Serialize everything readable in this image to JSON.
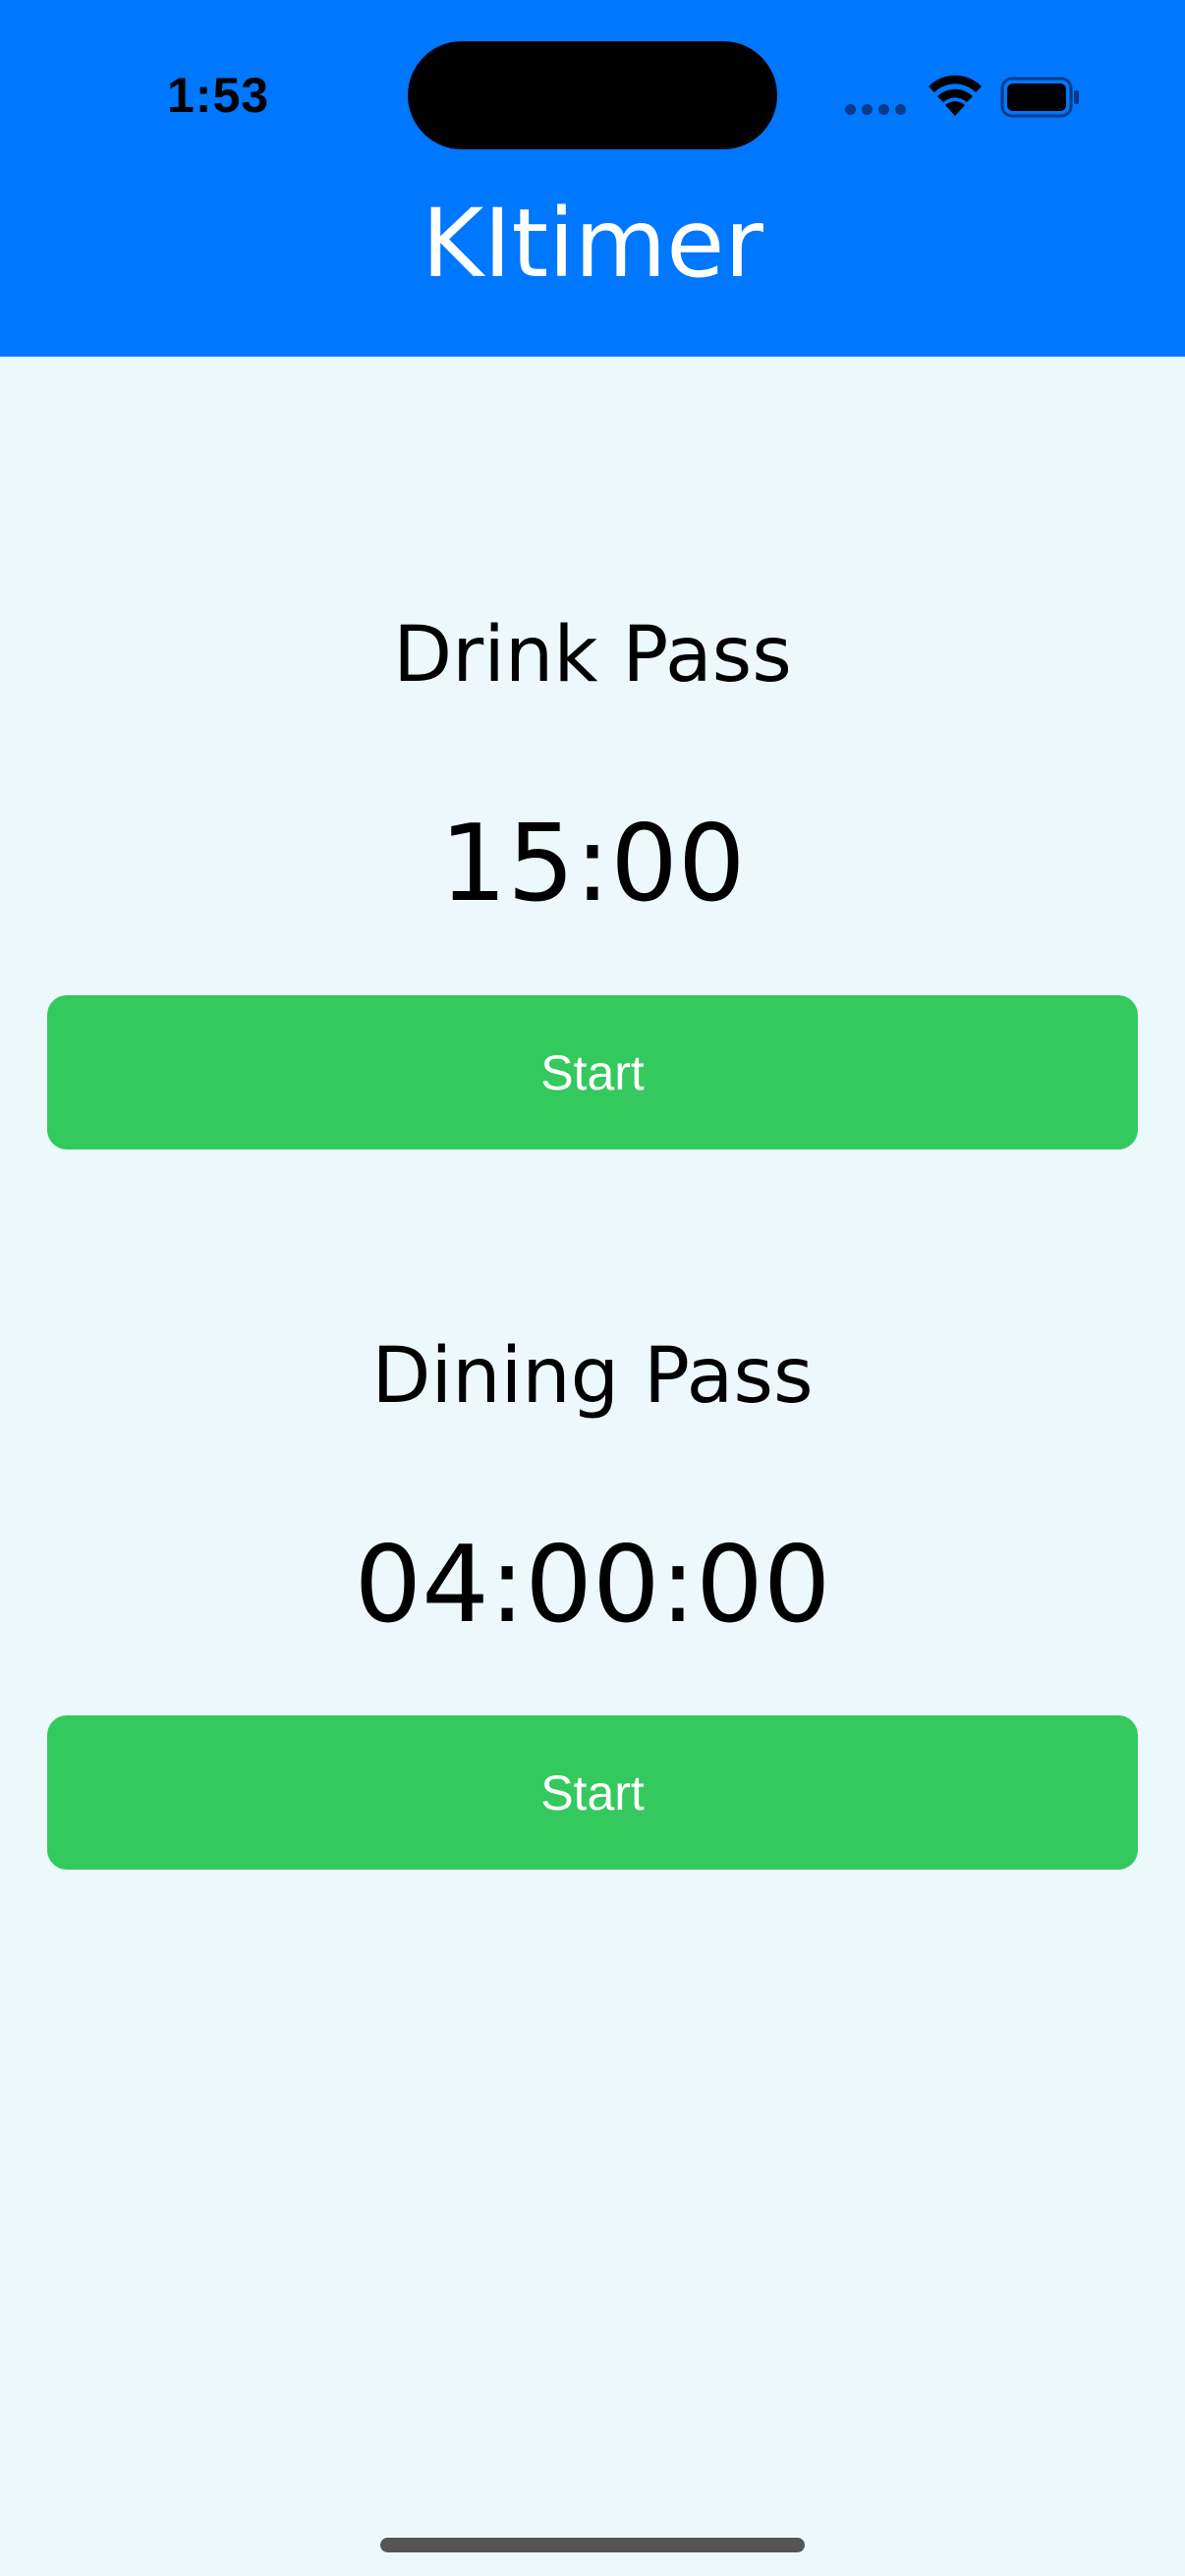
{
  "status_bar": {
    "time": "1:53"
  },
  "header": {
    "title": "KItimer",
    "background": "#0077FF"
  },
  "timers": [
    {
      "name": "Drink Pass",
      "time": "15:00",
      "button_label": "Start"
    },
    {
      "name": "Dining Pass",
      "time": "04:00:00",
      "button_label": "Start"
    }
  ],
  "colors": {
    "accent": "#0077FF",
    "button": "#34C95C",
    "background": "#EDF8FC"
  },
  "icons": [
    "wifi-icon",
    "battery-icon",
    "cellular-signal-icon"
  ]
}
